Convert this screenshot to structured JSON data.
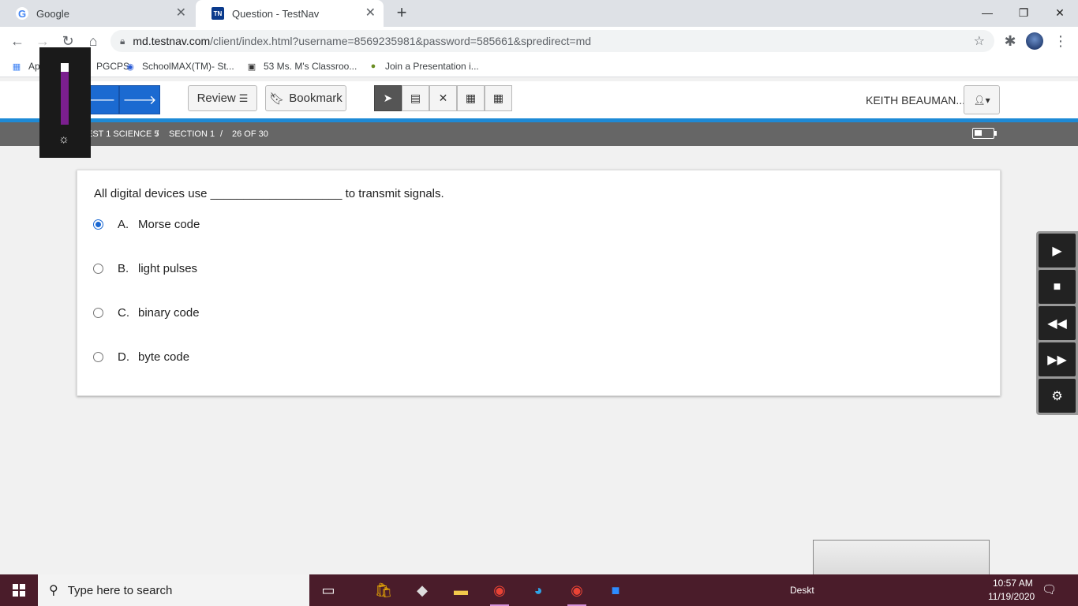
{
  "browser": {
    "tabs": [
      {
        "title": "Google",
        "favicon": "G"
      },
      {
        "title": "Question - TestNav",
        "favicon": "TN"
      }
    ],
    "url_host": "md.testnav.com",
    "url_path": "/client/index.html?username=8569235981&password=585661&spredirect=md",
    "bookmarks": [
      {
        "label": "Apps",
        "icon": "apps-grid-icon"
      },
      {
        "label": "PGCPS",
        "icon": "folder-icon"
      },
      {
        "label": "SchoolMAX(TM)- St...",
        "icon": "globe-icon"
      },
      {
        "label": "53 Ms. M's Classroo...",
        "icon": "classroom-icon"
      },
      {
        "label": "Join a Presentation i...",
        "icon": "presentation-icon"
      }
    ]
  },
  "testnav": {
    "review_label": "Review",
    "bookmark_label": "Bookmark",
    "username": "KEITH BEAUMAN...",
    "breadcrumb": {
      "test": "EST 1 SCIENCE 5",
      "sep1": "/",
      "section": "SECTION 1",
      "sep2": "/",
      "progress": "26 OF 30"
    }
  },
  "question": {
    "stem_before": "All digital devices use",
    "stem_blank": "____________________",
    "stem_after": "to transmit signals.",
    "options": [
      {
        "letter": "A.",
        "text": "Morse code",
        "selected": true
      },
      {
        "letter": "B.",
        "text": "light pulses",
        "selected": false
      },
      {
        "letter": "C.",
        "text": "binary code",
        "selected": false
      },
      {
        "letter": "D.",
        "text": "byte code",
        "selected": false
      }
    ]
  },
  "taskbar": {
    "search_placeholder": "Type here to search",
    "desktop_label": "Deskt",
    "time": "10:57 AM",
    "date": "11/19/2020"
  },
  "colors": {
    "accent": "#1b6ad1",
    "strip": "#1e8ad6",
    "crumb_bg": "#666666",
    "taskbar": "#4a1c2a"
  }
}
